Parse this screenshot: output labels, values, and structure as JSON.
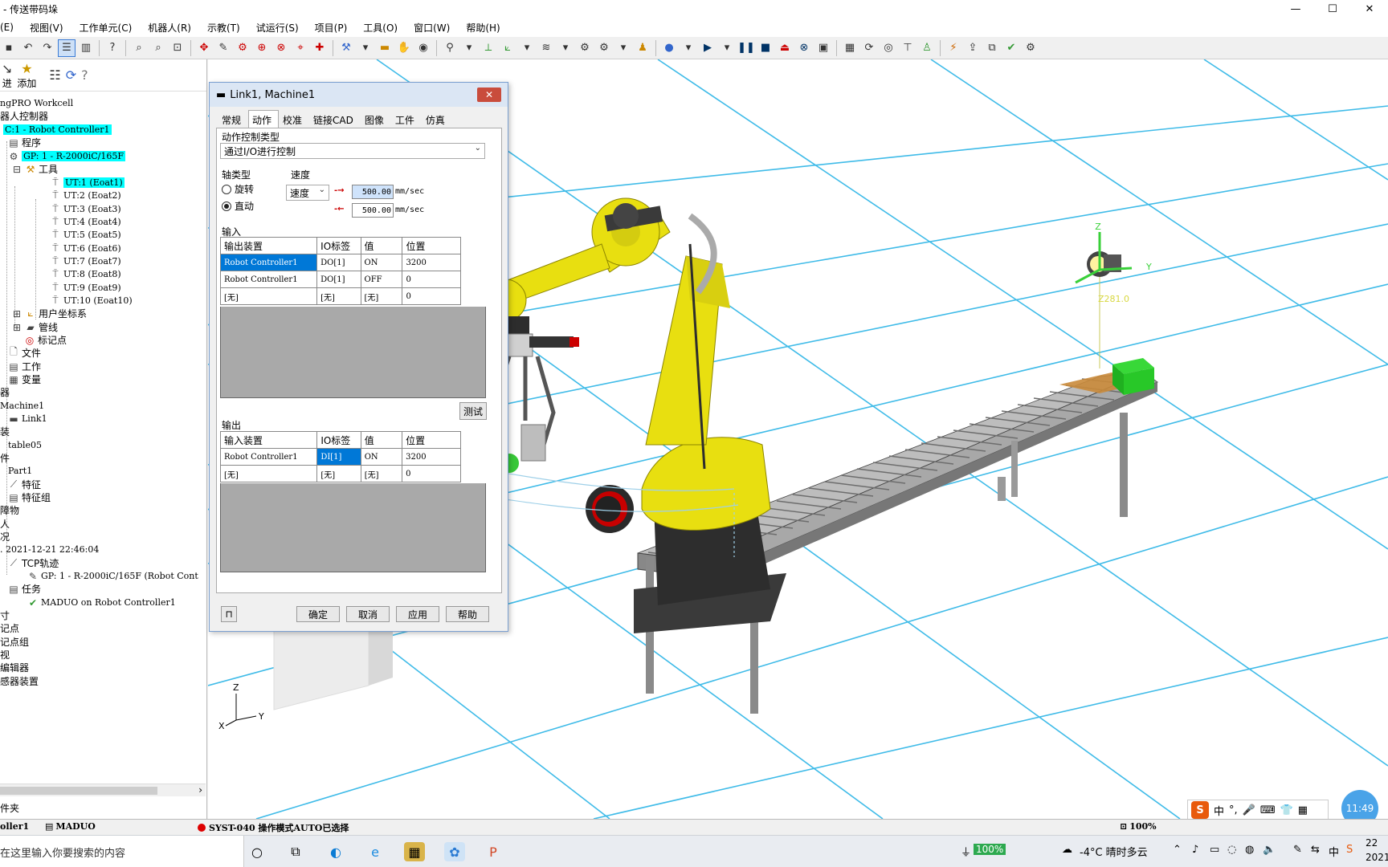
{
  "window": {
    "title": "- 传送带码垛",
    "min": "—",
    "max": "☐",
    "close": "✕"
  },
  "menu": [
    "(E)",
    "视图(V)",
    "工作单元(C)",
    "机器人(R)",
    "示教(T)",
    "试运行(S)",
    "项目(P)",
    "工具(O)",
    "窗口(W)",
    "帮助(H)"
  ],
  "left_panel": {
    "toolbar": {
      "btn1": "进",
      "btn2": "添加"
    },
    "tree": {
      "root": "ngPRO Workcell",
      "robot_ctrl": "器人控制器",
      "controller": "C:1 - Robot Controller1",
      "program": "程序",
      "gp": "GP: 1 - R-2000iC/165F",
      "tools": "工具",
      "ut": [
        "UT:1  (Eoat1)",
        "UT:2  (Eoat2)",
        "UT:3  (Eoat3)",
        "UT:4  (Eoat4)",
        "UT:5  (Eoat5)",
        "UT:6  (Eoat6)",
        "UT:7  (Eoat7)",
        "UT:8  (Eoat8)",
        "UT:9  (Eoat9)",
        "UT:10  (Eoat10)"
      ],
      "user_frames": "用户坐标系",
      "pipeline": "管线",
      "markers": "标记点",
      "files": "文件",
      "work": "工作",
      "variables": "变量",
      "machines": "器",
      "machine1": "Machine1",
      "link1": "Link1",
      "fixtures": "装",
      "table05": "table05",
      "parts": "件",
      "part1": "Part1",
      "features": "特征",
      "feature_groups": "特征组",
      "obstacles": "障物",
      "people": "人",
      "status": "况",
      "timestamp": ". 2021-12-21 22:46:04",
      "tcp_trace": "TCP轨迹",
      "gp_trace": "GP: 1 - R-2000iC/165F (Robot Cont",
      "tasks": "任务",
      "task1": "MADUO on Robot Controller1",
      "measure": "寸",
      "points": "记点",
      "point_groups": "记点组",
      "view": "视",
      "editor": "编辑器",
      "sensors": "感器装置"
    },
    "footer": "件夹"
  },
  "dialog": {
    "title": "Link1, Machine1",
    "close": "✕",
    "tabs": [
      "常规",
      "动作",
      "校准",
      "链接CAD",
      "图像",
      "工件",
      "仿真"
    ],
    "active_tab": "动作",
    "motion_type_label": "动作控制类型",
    "motion_type_value": "通过I/O进行控制",
    "axis_type_label": "轴类型",
    "axis_rotate": "旋转",
    "axis_linear": "直动",
    "speed_group_label": "速度",
    "speed_select": "速度",
    "speed_forward": "500.00",
    "speed_reverse": "500.00",
    "speed_unit": "mm/sec",
    "input_label": "输入",
    "input_headers": [
      "输出装置",
      "IO标签",
      "值",
      "位置"
    ],
    "input_rows": [
      [
        "Robot Controller1",
        "DO[1]",
        "ON",
        "3200"
      ],
      [
        "Robot Controller1",
        "DO[1]",
        "OFF",
        "0"
      ],
      [
        "[无]",
        "[无]",
        "[无]",
        "0"
      ]
    ],
    "test_button": "测试",
    "output_label": "输出",
    "output_headers": [
      "输入装置",
      "IO标签",
      "值",
      "位置"
    ],
    "output_rows": [
      [
        "Robot Controller1",
        "DI[1]",
        "ON",
        "3200"
      ],
      [
        "[无]",
        "[无]",
        "[无]",
        "0"
      ]
    ],
    "ok": "确定",
    "cancel": "取消",
    "apply": "应用",
    "help": "帮助"
  },
  "viewport": {
    "z_readout": "Z281.0",
    "axis_z": "Z",
    "axis_y": "Y",
    "axis_x": "X",
    "gizmo_z": "Z",
    "gizmo_y": "Y"
  },
  "statusbar": {
    "controller": "oller1",
    "program": "MADUO",
    "message": "SYST-040 操作模式AUTO已选择",
    "zoom": "100%"
  },
  "taskbar": {
    "search_placeholder": "在这里输入你要搜索的内容",
    "battery": "100%",
    "weather": "-4°C  晴时多云",
    "time": "22",
    "date": "2021",
    "clock_bubble": "11:49",
    "ime_lang": "中"
  }
}
